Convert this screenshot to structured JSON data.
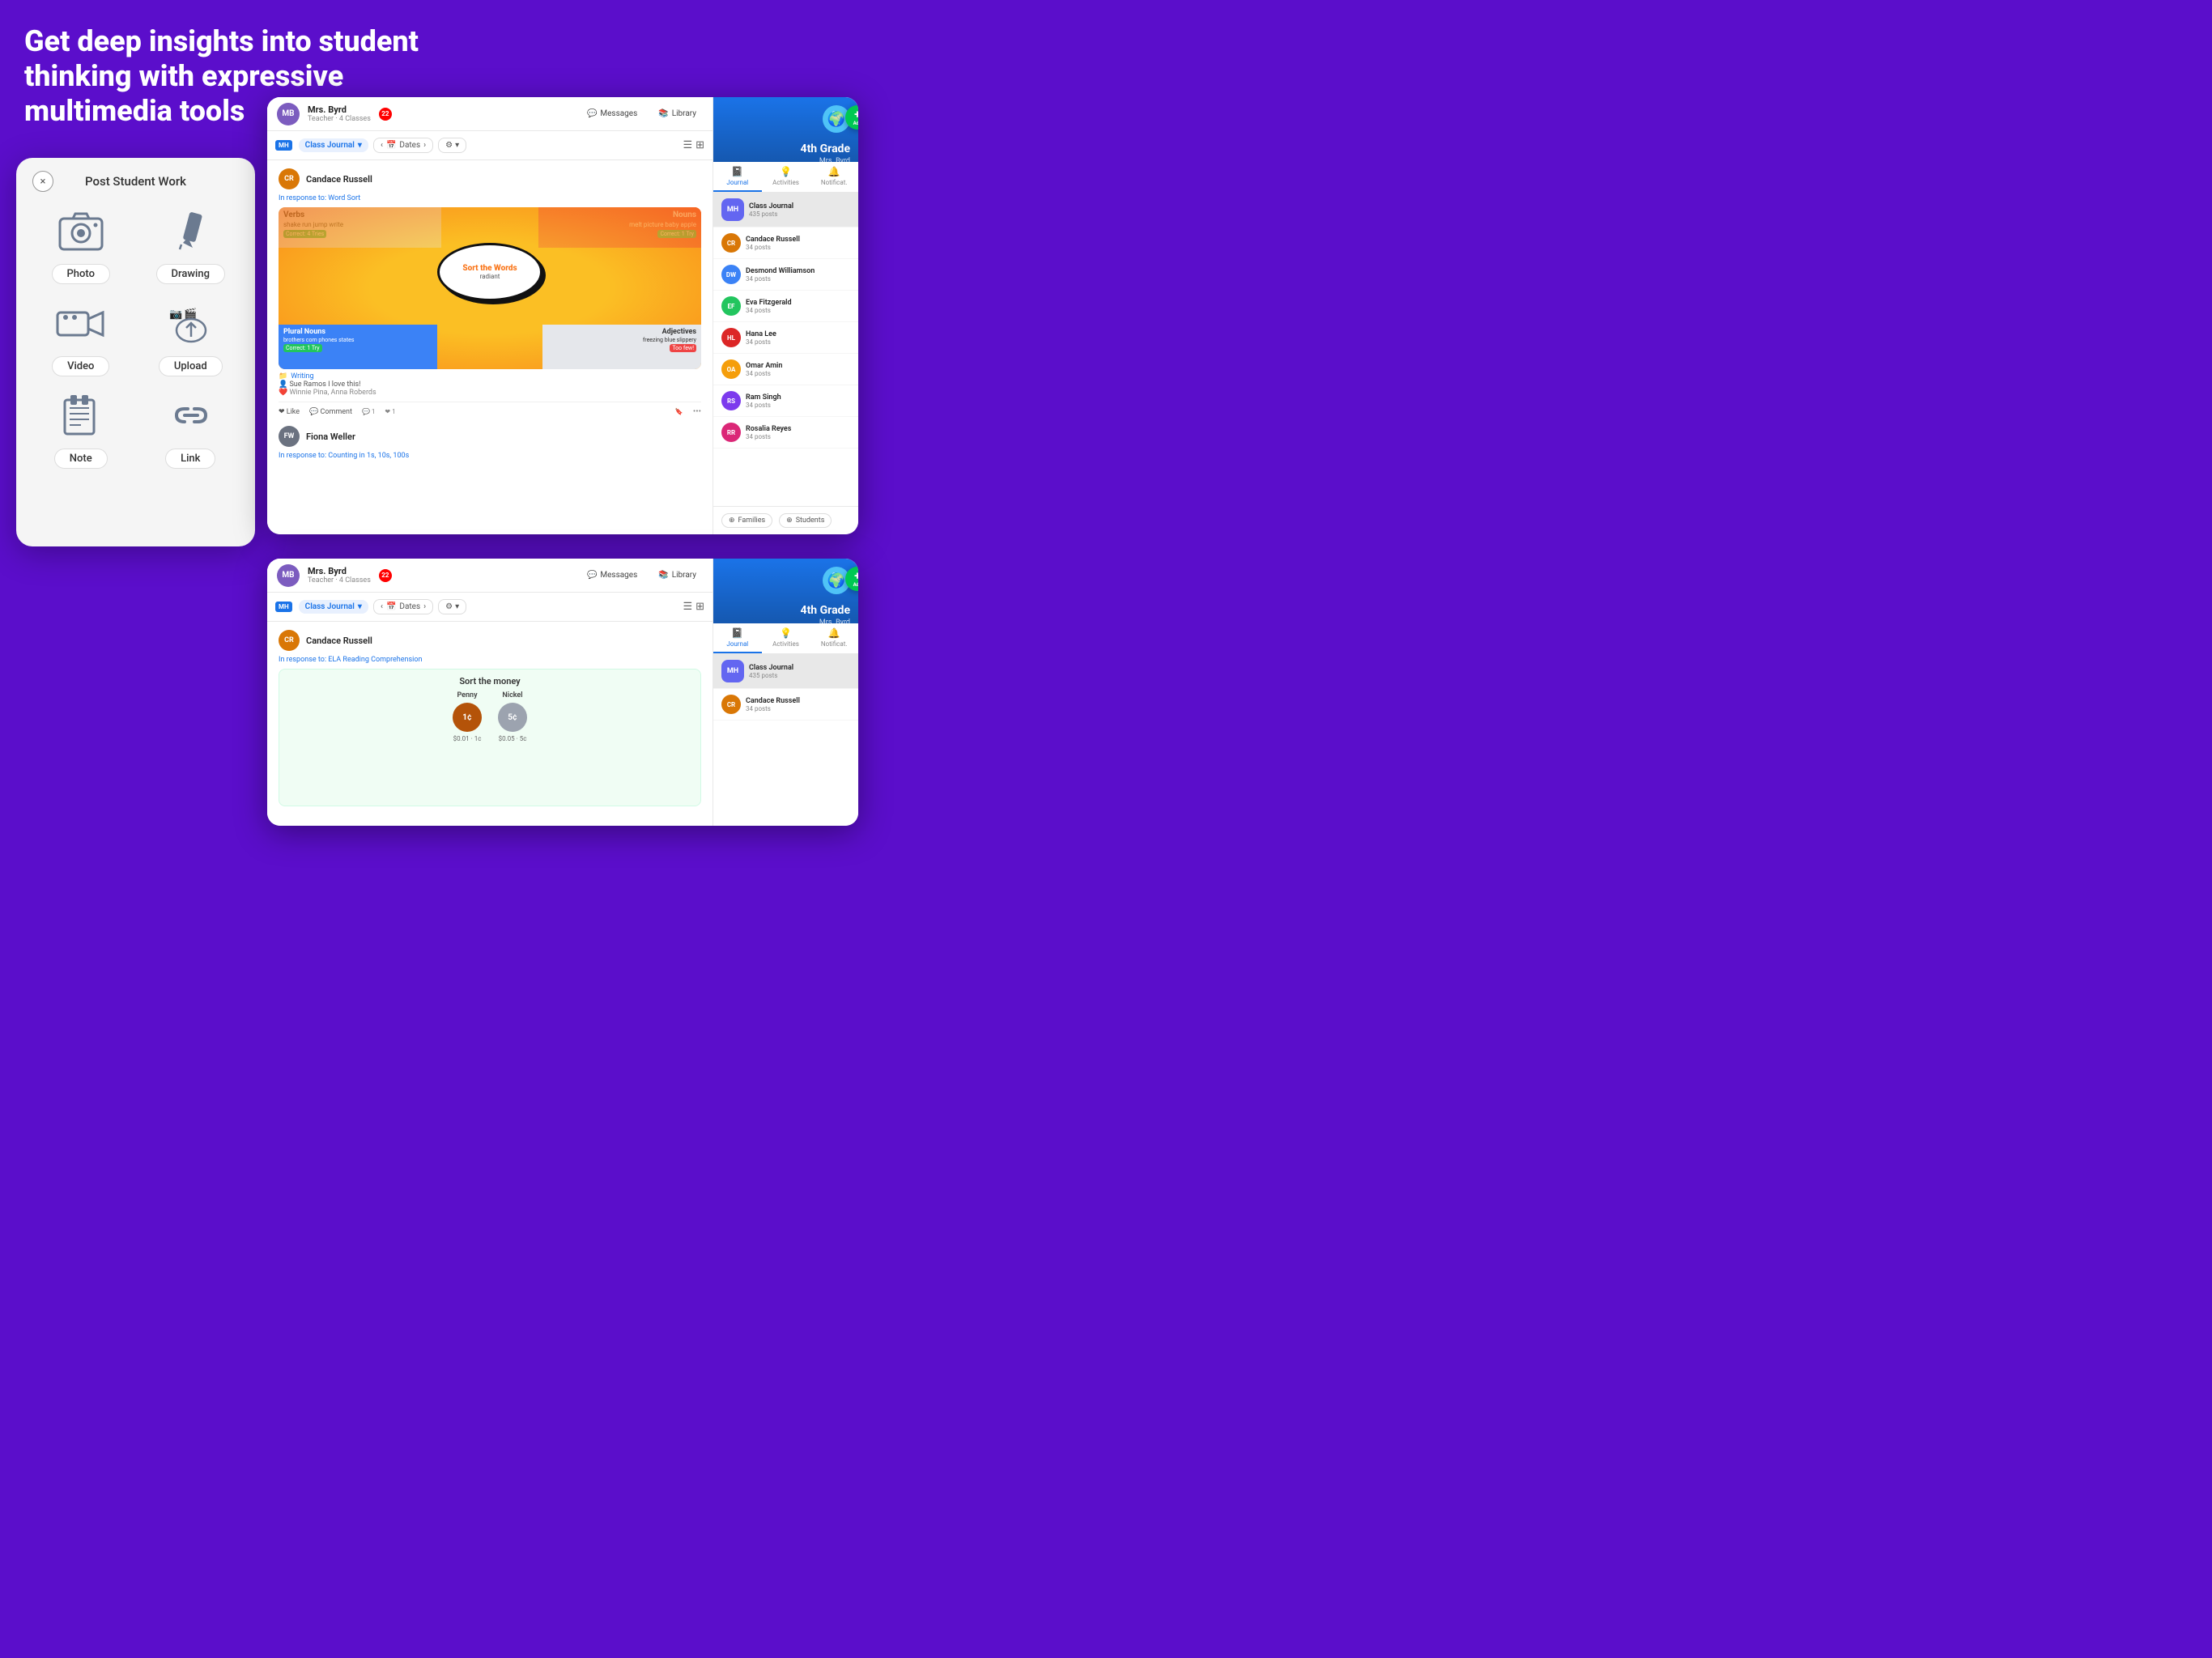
{
  "page": {
    "headline": "Get deep insights into student thinking with expressive multimedia tools"
  },
  "modal": {
    "title": "Post Student Work",
    "close_label": "×",
    "items": [
      {
        "id": "photo",
        "label": "Photo",
        "icon": "📷"
      },
      {
        "id": "drawing",
        "label": "Drawing",
        "icon": "✏️"
      },
      {
        "id": "video",
        "label": "Video",
        "icon": "🎥"
      },
      {
        "id": "upload",
        "label": "Upload",
        "icon": "☁️"
      },
      {
        "id": "note",
        "label": "Note",
        "icon": "📋"
      },
      {
        "id": "link",
        "label": "Link",
        "icon": "🔗"
      }
    ]
  },
  "app1": {
    "teacher_name": "Mrs. Byrd",
    "teacher_sub": "Teacher · 4 Classes",
    "badge": "22",
    "messages": "Messages",
    "library": "Library",
    "journal_label": "Class Journal",
    "dates_label": "Dates",
    "add_label": "Add",
    "posts": [
      {
        "student": "Candace Russell",
        "avatar_color": "#d97706",
        "avatar_initials": "CR",
        "response_to": "In response to: Word Sort",
        "activity_type": "sort_words",
        "tag": "Writing",
        "comment_user": "Sue Ramos",
        "comment_text": "I love this!",
        "likes": "Winnie Pina, Anna Roberds"
      },
      {
        "student": "Fiona Weller",
        "avatar_color": "#6b7280",
        "avatar_initials": "FW",
        "response_to": "In response to: Counting in 1s, 10s, 100s",
        "activity_type": "counting"
      }
    ],
    "sort_words": {
      "title": "Sort the Words",
      "subtitle": "radiant",
      "verbs_title": "Verbs",
      "verbs_words": "shake  run  jump\nwrite",
      "verbs_result": "Correct: 4 Tries",
      "nouns_title": "Nouns",
      "nouns_words": "melt  picture\nbaby  apple",
      "nouns_result": "Correct: 1 Try",
      "plural_title": "Plural Nouns",
      "plural_words": "brothers  corn  phones\nstates",
      "plural_result": "Correct: 1 Try",
      "adj_title": "Adjectives",
      "adj_words": "freezing  blue\nslippery",
      "adj_result": "Too few!"
    }
  },
  "app2": {
    "teacher_name": "Mrs. Byrd",
    "teacher_sub": "Teacher · 4 Classes",
    "badge": "22",
    "messages": "Messages",
    "library": "Library",
    "journal_label": "Class Journal",
    "dates_label": "Dates",
    "post_student": "Candace Russell",
    "post_avatar_color": "#d97706",
    "post_avatar_initials": "CR",
    "response_to": "In response to: ELA Reading Comprehension",
    "sort_money_title": "Sort the money",
    "penny_label": "Penny",
    "penny_values": "$0.01 · 1c",
    "nickel_label": "Nickel",
    "nickel_values": "$0.05 · 5c"
  },
  "sidebar": {
    "grade": "4th Grade",
    "teacher": "Mrs. Byrd",
    "tabs": [
      {
        "id": "journal",
        "label": "Journal",
        "icon": "📓",
        "active": true
      },
      {
        "id": "activities",
        "label": "Activities",
        "icon": "💡"
      },
      {
        "id": "notifications",
        "label": "Notificat.",
        "icon": "🔔"
      }
    ],
    "items": [
      {
        "id": "class",
        "label": "Class Journal",
        "posts": "435 posts",
        "color": "#6366f1",
        "initials": "MH",
        "active": true
      },
      {
        "id": "candace",
        "label": "Candace Russell",
        "posts": "34 posts",
        "color": "#d97706",
        "initials": "CR"
      },
      {
        "id": "desmond",
        "label": "Desmond Williamson",
        "posts": "34 posts",
        "color": "#3b82f6",
        "initials": "DW"
      },
      {
        "id": "eva",
        "label": "Eva Fitzgerald",
        "posts": "34 posts",
        "color": "#22c55e",
        "initials": "EF"
      },
      {
        "id": "hana",
        "label": "Hana Lee",
        "posts": "34 posts",
        "color": "#dc2626",
        "initials": "HL"
      },
      {
        "id": "omar",
        "label": "Omar Amin",
        "posts": "34 posts",
        "color": "#f59e0b",
        "initials": "OA"
      },
      {
        "id": "ram",
        "label": "Ram Singh",
        "posts": "34 posts",
        "color": "#7c3aed",
        "initials": "RS"
      },
      {
        "id": "rosalia",
        "label": "Rosalia Reyes",
        "posts": "34 posts",
        "color": "#db2777",
        "initials": "RR"
      }
    ],
    "families_btn": "Families",
    "students_btn": "Students"
  }
}
